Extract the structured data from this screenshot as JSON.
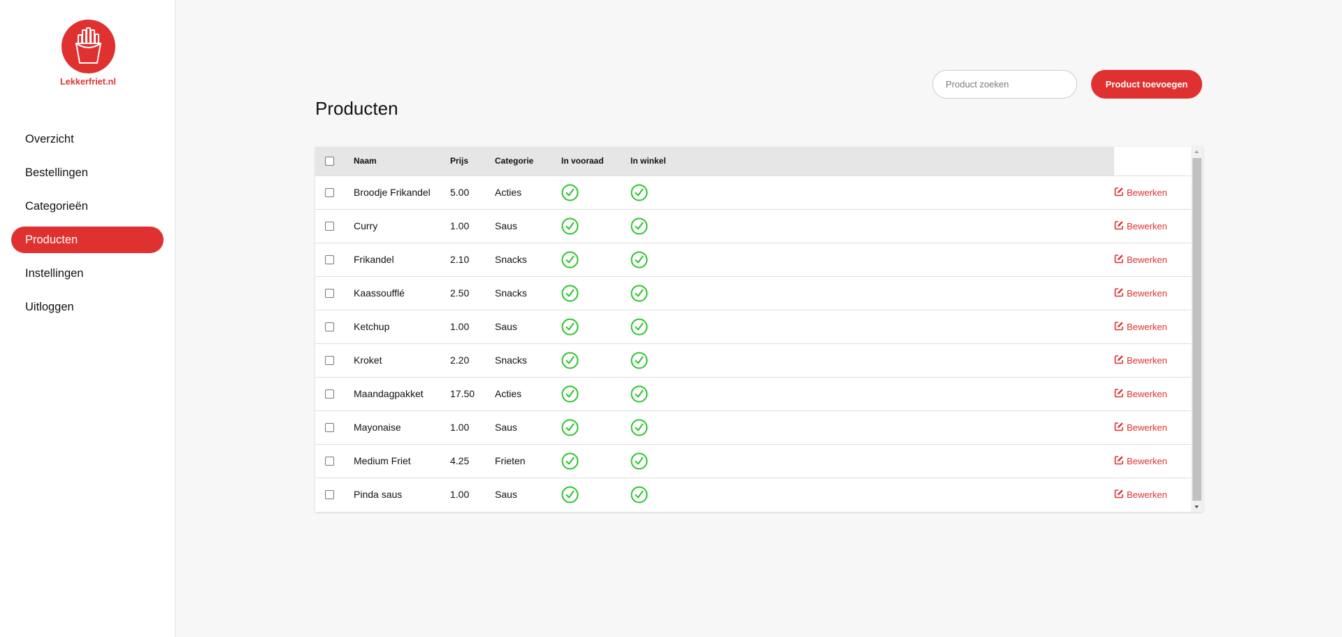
{
  "brand": {
    "name": "Lekkerfriet.nl",
    "color": "#e03131",
    "icon": "fries-icon"
  },
  "sidebar": {
    "items": [
      {
        "label": "Overzicht",
        "active": false
      },
      {
        "label": "Bestellingen",
        "active": false
      },
      {
        "label": "Categorieën",
        "active": false
      },
      {
        "label": "Producten",
        "active": true
      },
      {
        "label": "Instellingen",
        "active": false
      },
      {
        "label": "Uitloggen",
        "active": false
      }
    ]
  },
  "toolbar": {
    "search_placeholder": "Product zoeken",
    "add_label": "Product toevoegen"
  },
  "page": {
    "title": "Producten"
  },
  "table": {
    "columns": {
      "naam": "Naam",
      "prijs": "Prijs",
      "categorie": "Categorie",
      "voorraad": "In vooraad",
      "winkel": "In winkel"
    },
    "edit_label": "Bewerken",
    "status_color": "#2bc42b",
    "rows": [
      {
        "naam": "Broodje Frikandel",
        "prijs": "5.00",
        "categorie": "Acties",
        "voorraad": true,
        "winkel": true
      },
      {
        "naam": "Curry",
        "prijs": "1.00",
        "categorie": "Saus",
        "voorraad": true,
        "winkel": true
      },
      {
        "naam": "Frikandel",
        "prijs": "2.10",
        "categorie": "Snacks",
        "voorraad": true,
        "winkel": true
      },
      {
        "naam": "Kaassoufflé",
        "prijs": "2.50",
        "categorie": "Snacks",
        "voorraad": true,
        "winkel": true
      },
      {
        "naam": "Ketchup",
        "prijs": "1.00",
        "categorie": "Saus",
        "voorraad": true,
        "winkel": true
      },
      {
        "naam": "Kroket",
        "prijs": "2.20",
        "categorie": "Snacks",
        "voorraad": true,
        "winkel": true
      },
      {
        "naam": "Maandagpakket",
        "prijs": "17.50",
        "categorie": "Acties",
        "voorraad": true,
        "winkel": true
      },
      {
        "naam": "Mayonaise",
        "prijs": "1.00",
        "categorie": "Saus",
        "voorraad": true,
        "winkel": true
      },
      {
        "naam": "Medium Friet",
        "prijs": "4.25",
        "categorie": "Frieten",
        "voorraad": true,
        "winkel": true
      },
      {
        "naam": "Pinda saus",
        "prijs": "1.00",
        "categorie": "Saus",
        "voorraad": true,
        "winkel": true
      }
    ]
  }
}
